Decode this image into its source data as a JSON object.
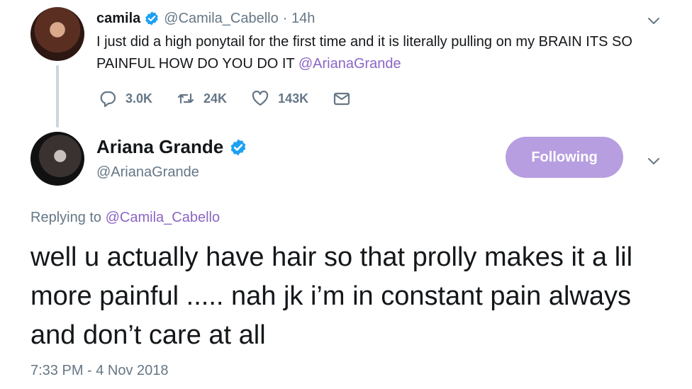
{
  "reply_to_tweet": {
    "author_name": "camila",
    "author_handle": "@Camila_Cabello",
    "time_ago": "· 14h",
    "text_part1": "I just did a high ponytail for the first time and it is literally pulling on my BRAIN ITS SO PAINFUL HOW DO YOU DO IT ",
    "mention": "@ArianaGrande",
    "actions": {
      "reply_count": "3.0K",
      "retweet_count": "24K",
      "like_count": "143K"
    }
  },
  "main_tweet": {
    "author_name": "Ariana Grande",
    "author_handle": "@ArianaGrande",
    "follow_button_label": "Following",
    "replying_prefix": "Replying to ",
    "replying_handle": "@Camila_Cabello",
    "text": "well u actually have hair so that prolly makes it a lil more painful ..... nah jk i’m in constant pain always and don’t care at all",
    "timestamp": "7:33 PM - 4 Nov 2018"
  },
  "colors": {
    "accent": "#8a66c4",
    "follow_button": "#b79ee0",
    "verified": "#1da1f2",
    "secondary_text": "#657786"
  }
}
